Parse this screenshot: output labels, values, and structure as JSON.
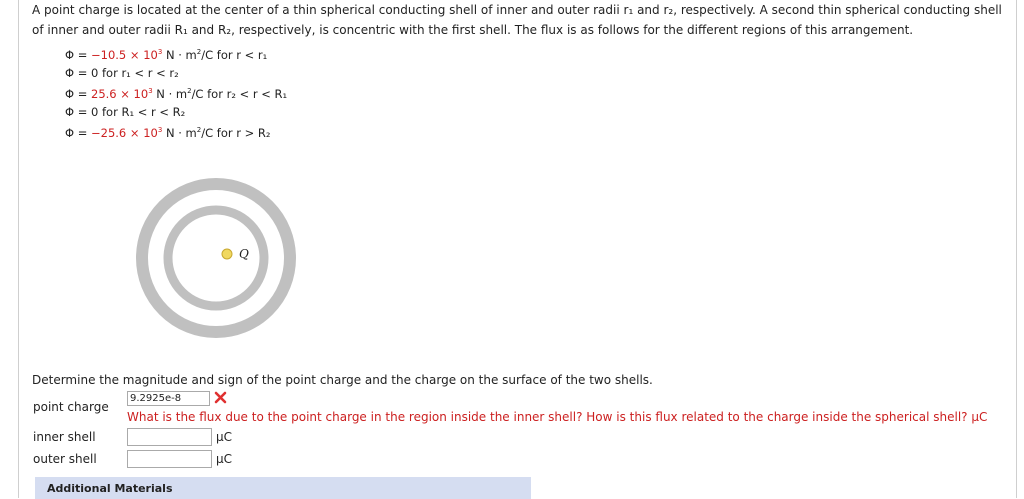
{
  "problem": {
    "intro_line1": "A point charge is located at the center of a thin spherical conducting shell of inner and outer radii r₁ and r₂, respectively. A second thin spherical conducting shell",
    "intro_line2": "of inner and outer radii R₁ and R₂, respectively, is concentric with the first shell. The flux is as follows for the different regions of this arrangement.",
    "flux_lines": [
      {
        "phi": "Φ = ",
        "value": "−10.5 × 10",
        "exp": "3",
        "unit": " N · m",
        "unit_exp": "2",
        "unit_tail": "/C",
        "region": " for r < r₁"
      },
      {
        "phi": "Φ = ",
        "value": "0",
        "exp": "",
        "unit": "",
        "unit_exp": "",
        "unit_tail": "",
        "region": " for r₁ < r < r₂"
      },
      {
        "phi": "Φ = ",
        "value": "25.6 × 10",
        "exp": "3",
        "unit": " N · m",
        "unit_exp": "2",
        "unit_tail": "/C",
        "region": " for r₂ < r < R₁"
      },
      {
        "phi": "Φ = ",
        "value": "0",
        "exp": "",
        "unit": "",
        "unit_exp": "",
        "unit_tail": "",
        "region": " for R₁ < r < R₂"
      },
      {
        "phi": "Φ = ",
        "value": "−25.6 × 10",
        "exp": "3",
        "unit": " N · m",
        "unit_exp": "2",
        "unit_tail": "/C",
        "region": " for r > R₂"
      }
    ],
    "diagram": {
      "charge_label": "Q",
      "ring_color": "#c0c0c0",
      "charge_color": "#f0d860"
    },
    "question": "Determine the magnitude and sign of the point charge and the charge on the surface of the two shells."
  },
  "answers": {
    "point_charge": {
      "label": "point charge",
      "value": "9.2925e-8",
      "status": "incorrect"
    },
    "hint": "What is the flux due to the point charge in the region inside the inner shell? How is this flux related to the charge inside the spherical shell? μC",
    "inner_shell": {
      "label": "inner shell",
      "value": "",
      "unit": "μC"
    },
    "outer_shell": {
      "label": "outer shell",
      "value": "",
      "unit": "μC"
    }
  },
  "additional": {
    "label": "Additional Materials"
  }
}
